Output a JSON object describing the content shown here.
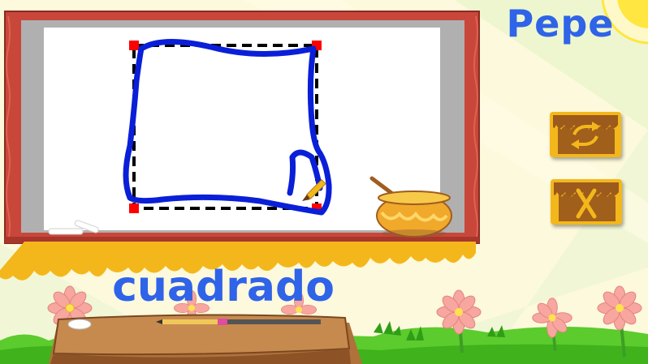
{
  "player": {
    "name": "Pepe"
  },
  "lesson": {
    "word": "cuadrado",
    "shape_icon": "square-outline"
  },
  "controls": {
    "repeat_icon": "repeat-arrows-icon",
    "close_icon": "close-x-icon"
  },
  "colors": {
    "text_blue": "#2f63e8",
    "drawing_stroke": "#0a1fd8",
    "honey": "#f4b71b",
    "board_frame": "#c9473a",
    "grass": "#5ccb2d"
  }
}
